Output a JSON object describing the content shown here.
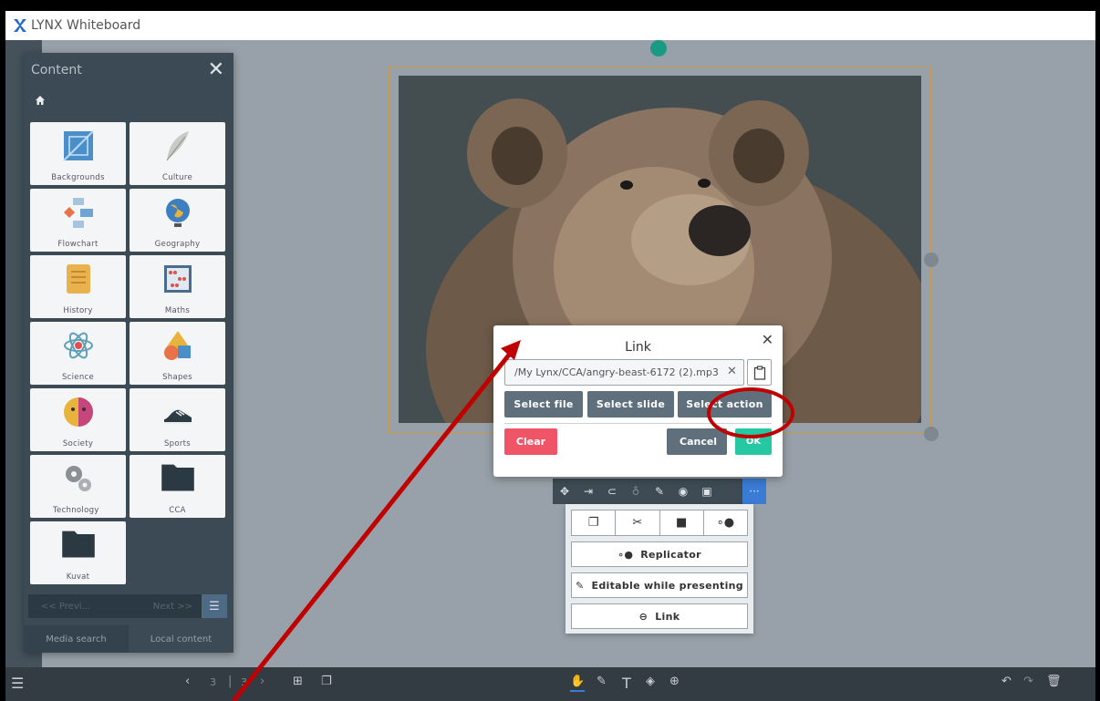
{
  "app": {
    "title": "LYNX Whiteboard",
    "accent": "#26c7a3",
    "danger": "#ef5467"
  },
  "content_panel": {
    "title": "Content",
    "close_icon": "close-icon",
    "home_icon": "home-icon",
    "tiles": [
      {
        "label": "Backgrounds"
      },
      {
        "label": "Culture"
      },
      {
        "label": "Flowchart"
      },
      {
        "label": "Geography"
      },
      {
        "label": "History"
      },
      {
        "label": "Maths"
      },
      {
        "label": "Science"
      },
      {
        "label": "Shapes"
      },
      {
        "label": "Society"
      },
      {
        "label": "Sports"
      },
      {
        "label": "Technology"
      },
      {
        "label": "CCA"
      },
      {
        "label": "Kuvat"
      }
    ],
    "pager": {
      "prev": "<< Previ...",
      "next": "Next >>"
    },
    "tabs": {
      "media_search": "Media search",
      "local_content": "Local content"
    }
  },
  "bottom_bar": {
    "page_current": "3",
    "page_total": "3"
  },
  "link_dialog": {
    "title": "Link",
    "path_value": "/My Lynx/CCA/angry-beast-6172 (2).mp3",
    "select_file": "Select file",
    "select_slide": "Select slide",
    "select_action": "Select action",
    "clear": "Clear",
    "cancel": "Cancel",
    "ok": "OK"
  },
  "object_menu": {
    "replicator": "Replicator",
    "editable": "Editable while presenting",
    "link": "Link"
  }
}
